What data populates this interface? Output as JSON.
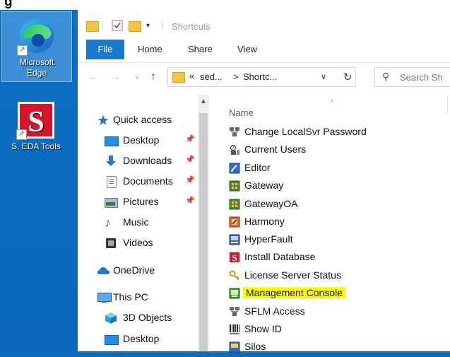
{
  "desktop": {
    "icons": [
      {
        "label_lines": [
          "Microsoft",
          "Edge"
        ]
      },
      {
        "label_lines": [
          "S. EDA Tools"
        ]
      }
    ]
  },
  "explorer": {
    "title": "Shortcuts",
    "ribbon_tabs": [
      "File",
      "Home",
      "Share",
      "View"
    ],
    "address": {
      "prefix": "«",
      "segments": [
        "sed...",
        "Shortc..."
      ],
      "separator": ">"
    },
    "search_placeholder": "Search Sh",
    "column_header": "Name",
    "nav_items": [
      {
        "label": "Quick access"
      },
      {
        "label": "Desktop"
      },
      {
        "label": "Downloads"
      },
      {
        "label": "Documents"
      },
      {
        "label": "Pictures"
      },
      {
        "label": "Music"
      },
      {
        "label": "Videos"
      },
      {
        "label": "OneDrive"
      },
      {
        "label": "This PC"
      },
      {
        "label": "3D Objects"
      },
      {
        "label": "Desktop"
      }
    ],
    "files": [
      {
        "label": "Change LocalSvr Password"
      },
      {
        "label": "Current Users"
      },
      {
        "label": "Editor"
      },
      {
        "label": "Gateway"
      },
      {
        "label": "GatewayOA"
      },
      {
        "label": "Harmony"
      },
      {
        "label": "HyperFault"
      },
      {
        "label": "Install Database"
      },
      {
        "label": "License Server Status"
      },
      {
        "label": "Management Console",
        "highlight": "#ffff00"
      },
      {
        "label": "SFLM Access"
      },
      {
        "label": "Show ID"
      },
      {
        "label": "Silos"
      }
    ]
  },
  "colors": {
    "desktop_blue": "#0a6cbd",
    "file_tab": "#1979ca",
    "highlight": "#ffff00"
  }
}
